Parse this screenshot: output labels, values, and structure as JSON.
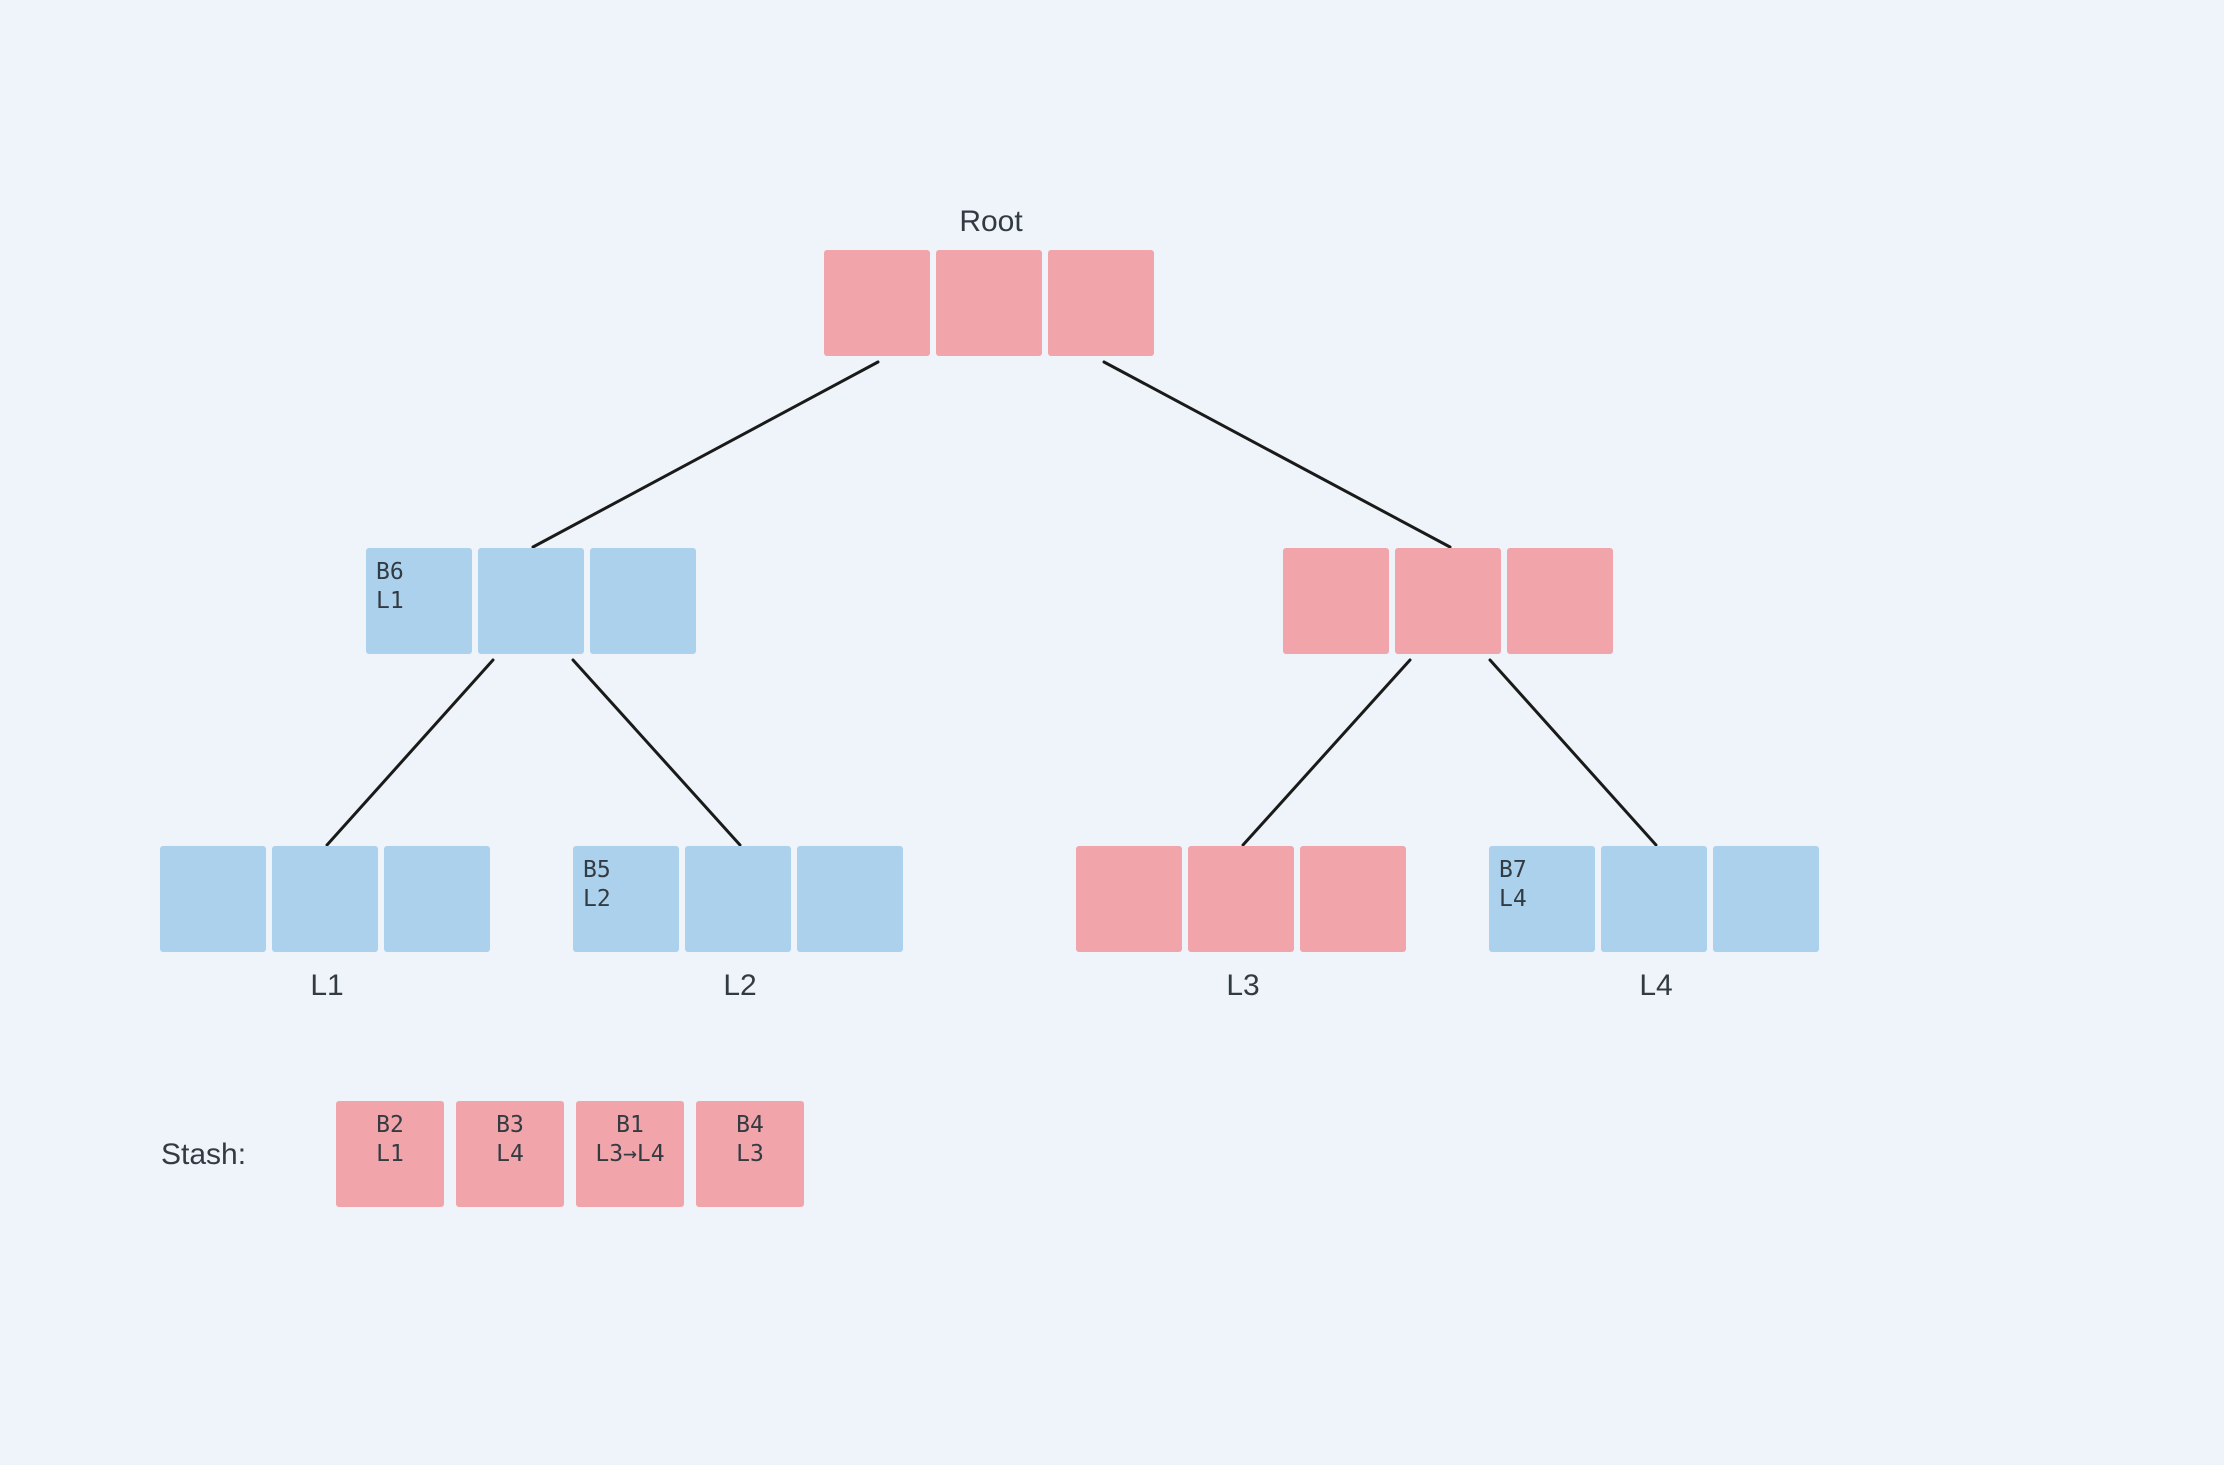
{
  "title": "Root",
  "colors": {
    "pink": "#f1a5ab",
    "blue": "#acd1ed",
    "bg": "#eef4f9"
  },
  "tree": {
    "root": {
      "color": "pink",
      "cells": [
        {},
        {},
        {}
      ]
    },
    "left": {
      "color": "blue",
      "cells": [
        {
          "line1": "B6",
          "line2": "L1"
        },
        {},
        {}
      ]
    },
    "right": {
      "color": "pink",
      "cells": [
        {},
        {},
        {}
      ]
    },
    "L1": {
      "color": "blue",
      "cells": [
        {},
        {},
        {}
      ],
      "label": "L1"
    },
    "L2": {
      "color": "blue",
      "cells": [
        {
          "line1": "B5",
          "line2": "L2"
        },
        {},
        {}
      ],
      "label": "L2"
    },
    "L3": {
      "color": "pink",
      "cells": [
        {},
        {},
        {}
      ],
      "label": "L3"
    },
    "L4": {
      "color": "blue",
      "cells": [
        {
          "line1": "B7",
          "line2": "L4"
        },
        {},
        {}
      ],
      "label": "L4"
    }
  },
  "leaf_labels": {
    "L1": "L1",
    "L2": "L2",
    "L3": "L3",
    "L4": "L4"
  },
  "stash_label": "Stash:",
  "stash": [
    {
      "line1": "B2",
      "line2": "L1"
    },
    {
      "line1": "B3",
      "line2": "L4"
    },
    {
      "line1": "B1",
      "line2": "L3→L4"
    },
    {
      "line1": "B4",
      "line2": "L3"
    }
  ]
}
